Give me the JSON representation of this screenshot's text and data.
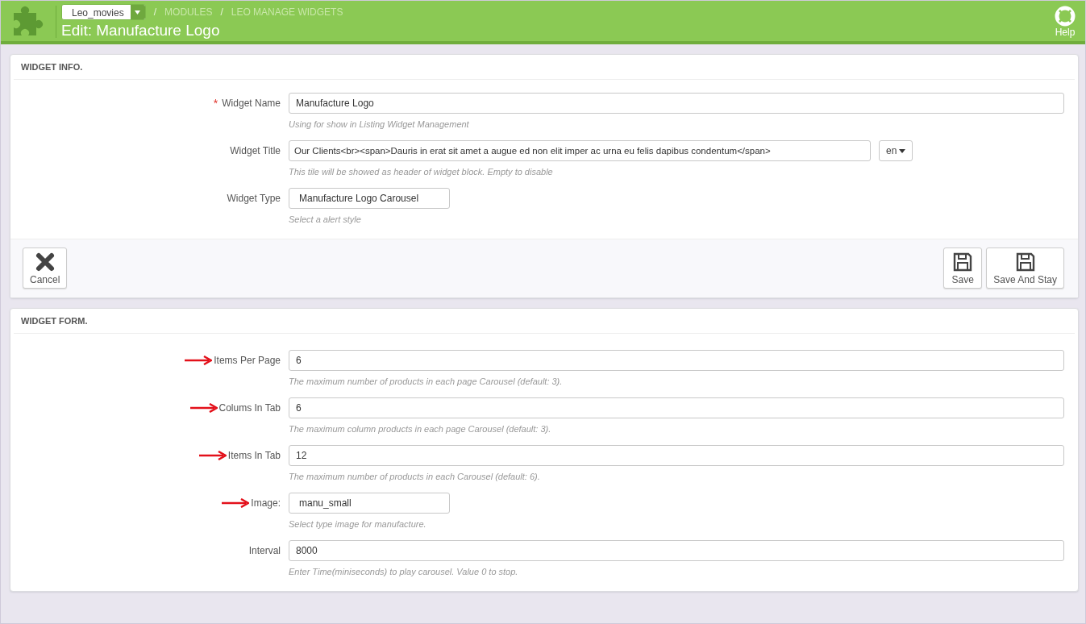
{
  "header": {
    "shop": "Leo_movies",
    "breadcrumbs": [
      "MODULES",
      "LEO MANAGE WIDGETS"
    ],
    "title": "Edit: Manufacture Logo",
    "help": "Help",
    "separator": "/"
  },
  "widget_info": {
    "heading": "WIDGET INFO.",
    "fields": [
      {
        "label": "Widget Name",
        "required_mark": "*",
        "kind": "text",
        "value": "Manufacture Logo",
        "help": "Using for show in Listing Widget Management"
      },
      {
        "label": "Widget Title",
        "kind": "lang",
        "value": "Our Clients<br><span>Dauris in erat sit amet a augue ed non elit imper ac urna eu felis dapibus condentum</span>",
        "lang": "en",
        "help": "This tile will be showed as header of widget block. Empty to disable"
      },
      {
        "label": "Widget Type",
        "kind": "select",
        "value": "Manufacture Logo Carousel",
        "help": "Select a alert style"
      }
    ],
    "buttons": [
      {
        "label": "Cancel",
        "kind": "cancel"
      },
      {
        "label": "Save",
        "kind": "save"
      },
      {
        "label": "Save And Stay",
        "kind": "save"
      }
    ]
  },
  "widget_form": {
    "heading": "WIDGET FORM.",
    "fields": [
      {
        "label": "Items Per Page",
        "kind": "text",
        "annotated": true,
        "value": "6",
        "help": "The maximum number of products in each page Carousel (default: 3)."
      },
      {
        "label": "Colums In Tab",
        "kind": "text",
        "annotated": true,
        "value": "6",
        "help": "The maximum column products in each page Carousel (default: 3)."
      },
      {
        "label": "Items In Tab",
        "kind": "text",
        "annotated": true,
        "value": "12",
        "help": "The maximum number of products in each Carousel (default: 6)."
      },
      {
        "label": "Image:",
        "kind": "select",
        "annotated": true,
        "value": "manu_small",
        "help": "Select type image for manufacture."
      },
      {
        "label": "Interval",
        "kind": "text",
        "annotated": false,
        "value": "8000",
        "help": "Enter Time(miniseconds) to play carousel. Value 0 to stop."
      }
    ]
  }
}
